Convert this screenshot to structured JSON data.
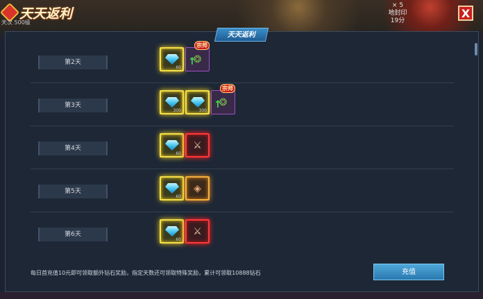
{
  "header": {
    "title": "天天返利",
    "sub_info": "天次 500级",
    "hud_line1": "× 5",
    "hud_line2": "地封印",
    "hud_line3": "19分",
    "close_label": "X"
  },
  "panel": {
    "tab_label": "天天返利"
  },
  "rows": [
    {
      "day": "第2天",
      "items": [
        {
          "kind": "diamond",
          "qty": "60"
        },
        {
          "kind": "purple",
          "badge": "宗师"
        }
      ]
    },
    {
      "day": "第3天",
      "items": [
        {
          "kind": "diamond",
          "qty": "300"
        },
        {
          "kind": "diamond",
          "qty": "300"
        },
        {
          "kind": "purple",
          "badge": "宗师"
        }
      ]
    },
    {
      "day": "第4天",
      "items": [
        {
          "kind": "diamond",
          "qty": "60"
        },
        {
          "kind": "red"
        }
      ]
    },
    {
      "day": "第5天",
      "items": [
        {
          "kind": "diamond",
          "qty": "60"
        },
        {
          "kind": "orange"
        }
      ]
    },
    {
      "day": "第6天",
      "items": [
        {
          "kind": "diamond",
          "qty": "60"
        },
        {
          "kind": "red"
        }
      ]
    }
  ],
  "footer": {
    "text": "每日首充值10元即可领取额外钻石奖励，指定天数还可领取特殊奖励，累计可领取10888钻石",
    "recharge_label": "充值"
  },
  "colors": {
    "accent": "#2a78b0",
    "gold_frame": "#f4e04a",
    "red_frame": "#ff3a3a",
    "orange_frame": "#f4b040"
  }
}
